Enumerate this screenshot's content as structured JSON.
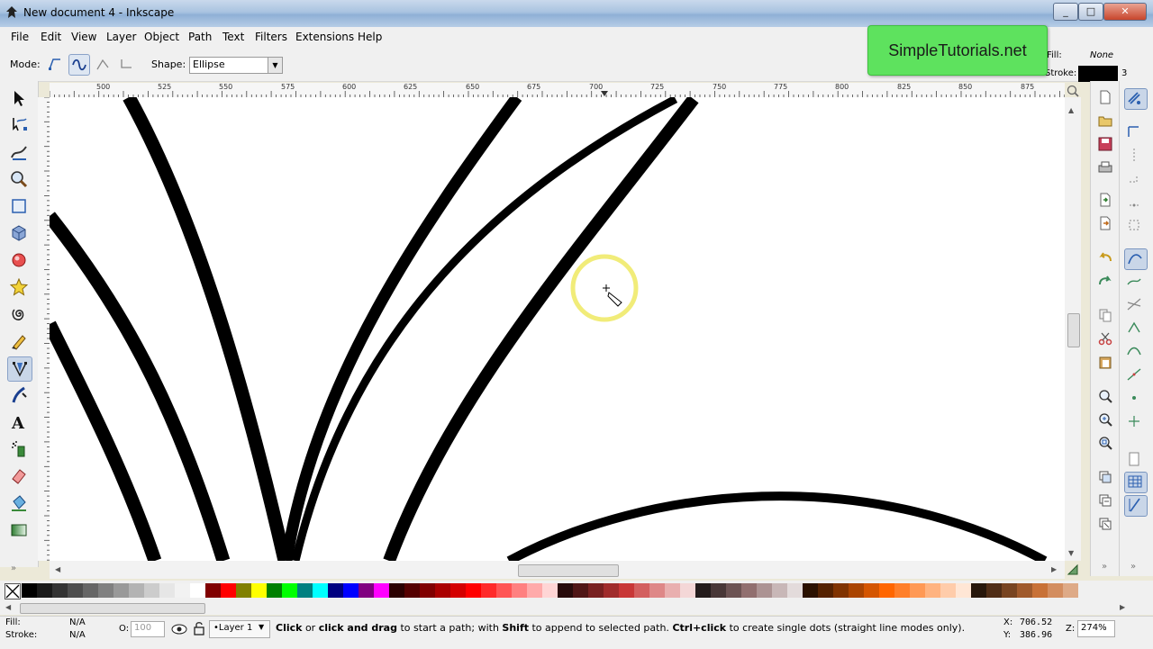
{
  "window": {
    "title": "New document 4 - Inkscape",
    "buttons": [
      "_",
      "□",
      "✕"
    ]
  },
  "menu": [
    "File",
    "Edit",
    "View",
    "Layer",
    "Object",
    "Path",
    "Text",
    "Filters",
    "Extensions",
    "Help"
  ],
  "toolcontrols": {
    "mode_label": "Mode:",
    "shape_label": "Shape:",
    "shape_value": "Ellipse",
    "fill_label": "Fill:",
    "fill_value": "None",
    "stroke_label": "Stroke:",
    "stroke_width": "3"
  },
  "brand": "SimpleTutorials.net",
  "ruler": {
    "h_labels": [
      "500",
      "525",
      "550",
      "575",
      "600",
      "625",
      "650",
      "675",
      "700",
      "725",
      "750",
      "775",
      "800",
      "825",
      "850",
      "875"
    ]
  },
  "status": {
    "fill_label": "Fill:",
    "fill_value": "N/A",
    "stroke_label": "Stroke:",
    "stroke_value": "N/A",
    "opacity_label": "O:",
    "opacity_value": "100",
    "layer": "•Layer 1",
    "msg_1": "Click",
    "msg_2": " or ",
    "msg_3": "click and drag",
    "msg_4": " to start a path; with ",
    "msg_5": "Shift",
    "msg_6": " to append to selected path. ",
    "msg_7": "Ctrl+click",
    "msg_8": " to create single dots (straight line modes only).",
    "x_label": "X:",
    "x_value": "706.52",
    "y_label": "Y:",
    "y_value": "386.96",
    "zoom_label": "Z:",
    "zoom_value": "274%"
  },
  "palette_colors": [
    "#000000",
    "#1a1a1a",
    "#333333",
    "#4d4d4d",
    "#666666",
    "#808080",
    "#999999",
    "#b3b3b3",
    "#cccccc",
    "#e6e6e6",
    "#f2f2f2",
    "#ffffff",
    "#800000",
    "#ff0000",
    "#808000",
    "#ffff00",
    "#008000",
    "#00ff00",
    "#008080",
    "#00ffff",
    "#000080",
    "#0000ff",
    "#800080",
    "#ff00ff",
    "#2b0000",
    "#550000",
    "#800000",
    "#aa0000",
    "#d40000",
    "#ff0000",
    "#ff2a2a",
    "#ff5555",
    "#ff8080",
    "#ffaaaa",
    "#ffd5d5",
    "#280b0b",
    "#501616",
    "#782121",
    "#a02c2c",
    "#c83737",
    "#d35f5f",
    "#de8787",
    "#e9afaf",
    "#f4d7d7",
    "#241c1c",
    "#483737",
    "#6c5353",
    "#916f6f",
    "#ac9393",
    "#c8b7b7",
    "#e3dbdb",
    "#2b1100",
    "#552200",
    "#803300",
    "#aa4400",
    "#d45500",
    "#ff6600",
    "#ff7f2a",
    "#ff9955",
    "#ffb380",
    "#ffccaa",
    "#ffe6d5",
    "#28170b",
    "#502d16",
    "#784421",
    "#a05a2c",
    "#c87137",
    "#d38d5f",
    "#deaa87"
  ]
}
